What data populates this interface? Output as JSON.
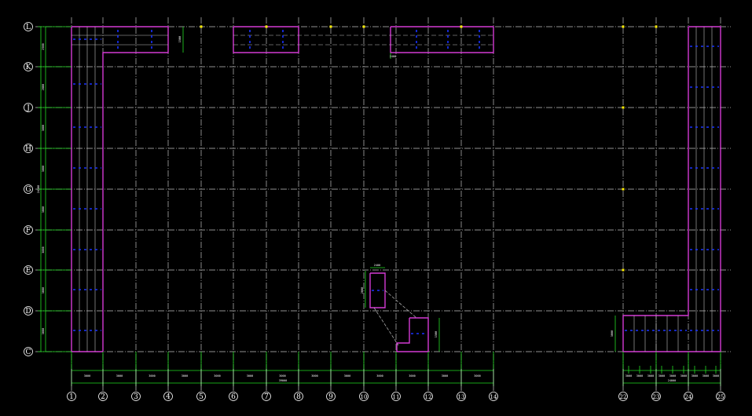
{
  "drawing": {
    "colors": {
      "background": "#000000",
      "grid_line": "#bfbfbf",
      "wall": "#d43ad4",
      "beam": "#1a32ff",
      "dimension": "#22dd22",
      "column": "#ffee00",
      "text": "#ffffff"
    },
    "row_axes": [
      {
        "label": "L"
      },
      {
        "label": "K"
      },
      {
        "label": "J"
      },
      {
        "label": "H"
      },
      {
        "label": "G"
      },
      {
        "label": "F"
      },
      {
        "label": "E"
      },
      {
        "label": "D"
      },
      {
        "label": "C"
      }
    ],
    "column_axes": [
      {
        "label": "1"
      },
      {
        "label": "2"
      },
      {
        "label": "3"
      },
      {
        "label": "4"
      },
      {
        "label": "5"
      },
      {
        "label": "6"
      },
      {
        "label": "7"
      },
      {
        "label": "8"
      },
      {
        "label": "9"
      },
      {
        "label": "10"
      },
      {
        "label": "11"
      },
      {
        "label": "12"
      },
      {
        "label": "13"
      },
      {
        "label": "14"
      },
      {
        "label": "22"
      },
      {
        "label": "23"
      },
      {
        "label": "24"
      },
      {
        "label": "25"
      }
    ],
    "left_dims": [
      "2900",
      "2800",
      "3000",
      "3000",
      "3000",
      "3000",
      "3000",
      "3000",
      "3000"
    ],
    "left_total": "24100",
    "bottom_dims": [
      "3000",
      "3000",
      "3000",
      "3000",
      "3000",
      "3000",
      "3000",
      "3000",
      "3000",
      "3000",
      "3000",
      "3000",
      "3000"
    ],
    "bottom_total": "39000",
    "right_dims": [
      "3000",
      "3000",
      "3000",
      "3000",
      "3000",
      "3000",
      "3000",
      "3000",
      "3000"
    ],
    "right_total": "24000",
    "notes": [
      "1500",
      "2000",
      "2400",
      "1500",
      "3000",
      "2400"
    ]
  }
}
